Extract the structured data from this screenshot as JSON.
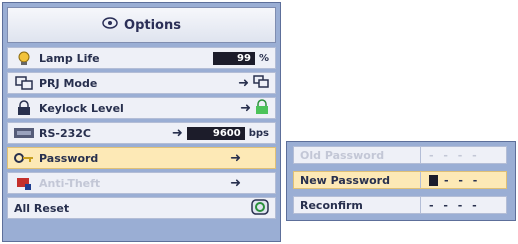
{
  "menu": {
    "title": "Options",
    "title_icon": "options-icon",
    "items": [
      {
        "label": "Lamp Life",
        "icon": "lamp-icon",
        "value": "99",
        "unit": "%"
      },
      {
        "label": "PRJ Mode",
        "icon": "prj-mode-icon"
      },
      {
        "label": "Keylock Level",
        "icon": "keylock-icon"
      },
      {
        "label": "RS-232C",
        "icon": "rs232c-icon",
        "value": "9600",
        "unit": "bps"
      },
      {
        "label": "Password",
        "icon": "password-key-icon"
      },
      {
        "label": "Anti-Theft",
        "icon": "anti-theft-icon"
      },
      {
        "label": "All Reset",
        "icon": "all-reset-icon"
      }
    ]
  },
  "password_panel": {
    "rows": [
      {
        "label": "Old Password",
        "value": "- - - -"
      },
      {
        "label": "New Password",
        "value": "- - -"
      },
      {
        "label": "Reconfirm",
        "value": "- - - -"
      }
    ]
  },
  "colors": {
    "panel": "#9aaed4",
    "row": "#eef0f7",
    "selected": "#fde9b6",
    "text": "#28304e"
  }
}
